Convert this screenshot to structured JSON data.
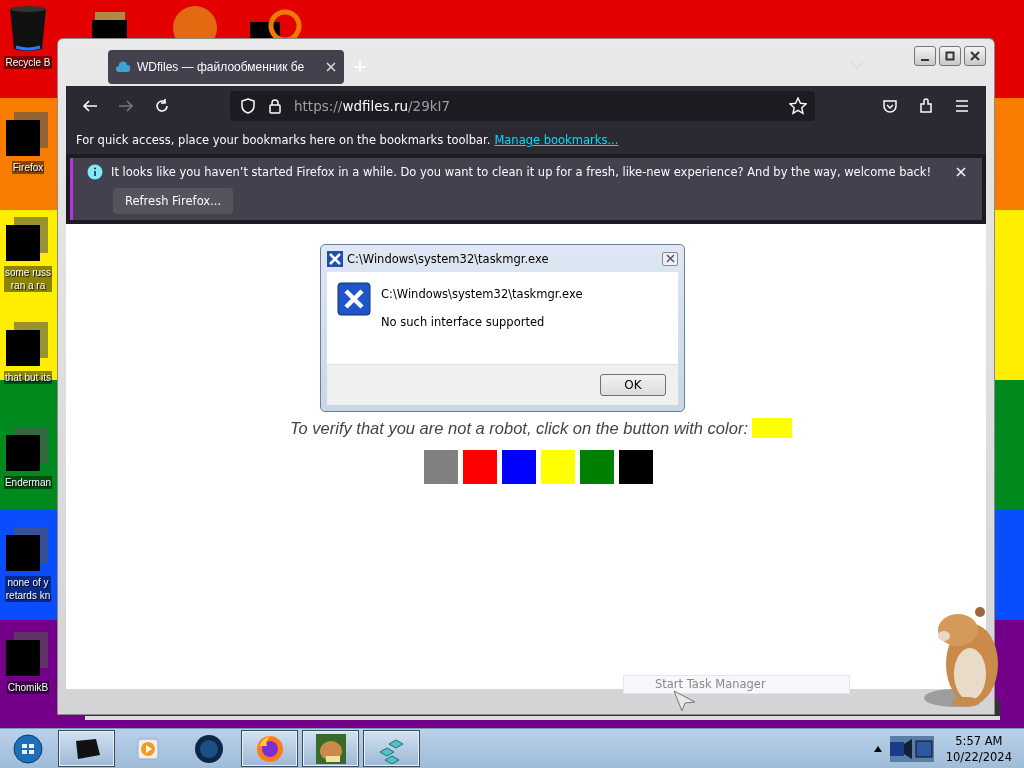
{
  "desktop_icons": [
    {
      "kind": "recycle-bin",
      "lines": [
        "Recycle B"
      ]
    },
    {
      "kind": "redacted",
      "lines": [
        "Firefox"
      ]
    },
    {
      "kind": "redacted",
      "lines": [
        "some russ",
        "ran a ra"
      ]
    },
    {
      "kind": "redacted",
      "lines": [
        "that but its"
      ]
    },
    {
      "kind": "redacted",
      "lines": [
        "Enderman"
      ]
    },
    {
      "kind": "redacted",
      "lines": [
        "none of y",
        "retards kn"
      ]
    },
    {
      "kind": "redacted",
      "lines": [
        "ChomikB"
      ]
    }
  ],
  "browser": {
    "tabs": [
      {
        "title": "WDfiles — файлообменник бе",
        "selected": true
      }
    ],
    "url": {
      "scheme": "https://",
      "host": "wdfiles.ru",
      "path": "/29kI7"
    },
    "bookmarks_bar": {
      "text": "For quick access, place your bookmarks here on the bookmarks toolbar.",
      "link": "Manage bookmarks..."
    },
    "notification": {
      "message": "It looks like you haven’t started Firefox in a while. Do you want to clean it up for a fresh, like-new experience? And by the way, welcome back!",
      "button": "Refresh Firefox..."
    },
    "page": {
      "prompt": "To verify that you are not a robot, click on the button with color:",
      "target_swatch": {
        "color": "#ffff00"
      },
      "choices": [
        {
          "color": "#808080"
        },
        {
          "color": "#ff0000"
        },
        {
          "color": "#0000ff"
        },
        {
          "color": "#ffff00"
        },
        {
          "color": "#008000"
        },
        {
          "color": "#000000"
        }
      ]
    }
  },
  "dialog": {
    "title": "C:\\Windows\\system32\\taskmgr.exe",
    "path": "C:\\Windows\\system32\\taskmgr.exe",
    "message": "No such interface supported",
    "button": "OK"
  },
  "context_menu": {
    "items": [
      "Start Task Manager"
    ]
  },
  "taskbar": {
    "apps": [
      {
        "kind": "terminal",
        "running": true
      },
      {
        "kind": "media",
        "running": false
      },
      {
        "kind": "globe",
        "running": false
      },
      {
        "kind": "firefox",
        "running": true
      },
      {
        "kind": "hamster",
        "running": true
      },
      {
        "kind": "cubes",
        "running": true
      }
    ],
    "clock": {
      "time": "5:57 AM",
      "date": "10/22/2024"
    }
  }
}
